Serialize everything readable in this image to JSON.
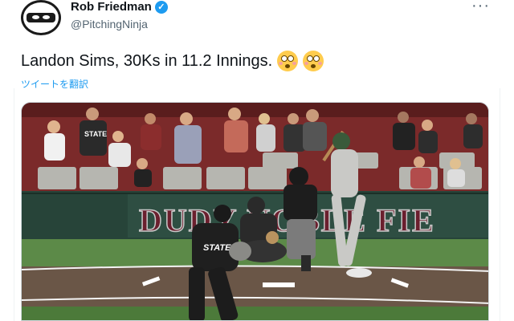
{
  "tweet": {
    "display_name": "Rob Friedman",
    "handle": "@PitchingNinja",
    "verified_icon": "verified-badge-icon",
    "more_icon": "more-options-icon",
    "text": "Landon Sims, 30Ks in 11.2 Innings.",
    "emojis": [
      "flushed-face-emoji",
      "flushed-face-emoji"
    ],
    "translate_link": "ツイートを翻訳"
  },
  "media": {
    "wall_text": "DUDY NOBLE FIE",
    "jersey_text": "STATE",
    "colors": {
      "wall": "#274439",
      "wall_letters": "#6b1f2e",
      "grass": "#4c7a3a",
      "dirt": "#6a5647",
      "accent": "#1d9bf0"
    }
  }
}
